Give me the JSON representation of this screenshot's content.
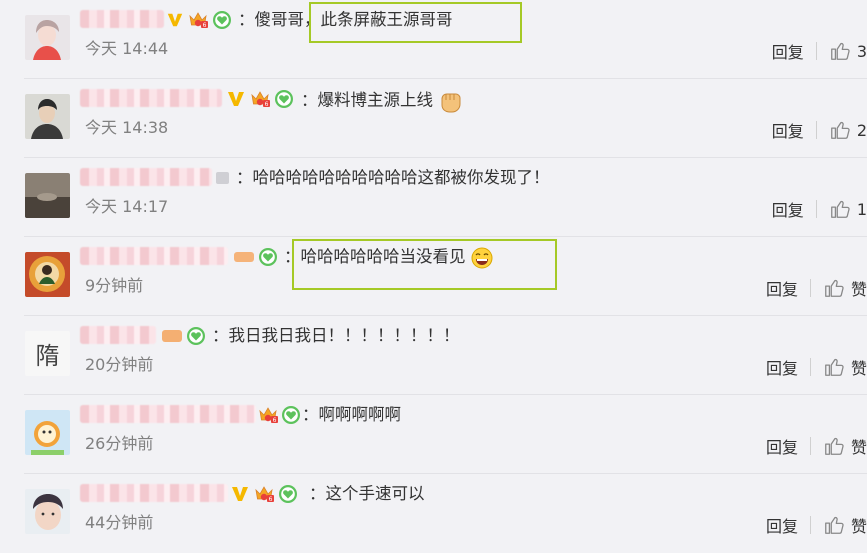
{
  "comments": [
    {
      "comment": "：傻哥哥，此条屏蔽王源哥哥",
      "time": "今天 14:44",
      "reply": "回复",
      "likes": "3"
    },
    {
      "comment": "：爆料博主源上线",
      "time": "今天 14:38",
      "reply": "回复",
      "likes": "2"
    },
    {
      "comment": "：哈哈哈哈哈哈哈哈哈哈这都被你发现了！",
      "time": "今天 14:17",
      "reply": "回复",
      "likes": "1"
    },
    {
      "comment": "：哈哈哈哈哈哈当没看见",
      "time": "9分钟前",
      "reply": "回复",
      "likes": "赞"
    },
    {
      "comment": "：我日我日我日！！！！！！！！",
      "time": "20分钟前",
      "reply": "回复",
      "likes": "赞"
    },
    {
      "comment": "：啊啊啊啊啊",
      "time": "26分钟前",
      "reply": "回复",
      "likes": "赞"
    },
    {
      "comment": "：这个手速可以",
      "time": "44分钟前",
      "reply": "回复",
      "likes": "赞"
    }
  ],
  "avatar_text": "隋",
  "colors": {
    "highlight": "#a5c926",
    "background": "#f2f2f5",
    "time": "#808080",
    "badge_green": "#5cc25c"
  },
  "icons": [
    "thumbs-up-icon",
    "vip-v-icon",
    "crown-badge-icon",
    "green-heart-badge-icon",
    "fist-emoji-icon",
    "laughing-emoji-icon"
  ]
}
